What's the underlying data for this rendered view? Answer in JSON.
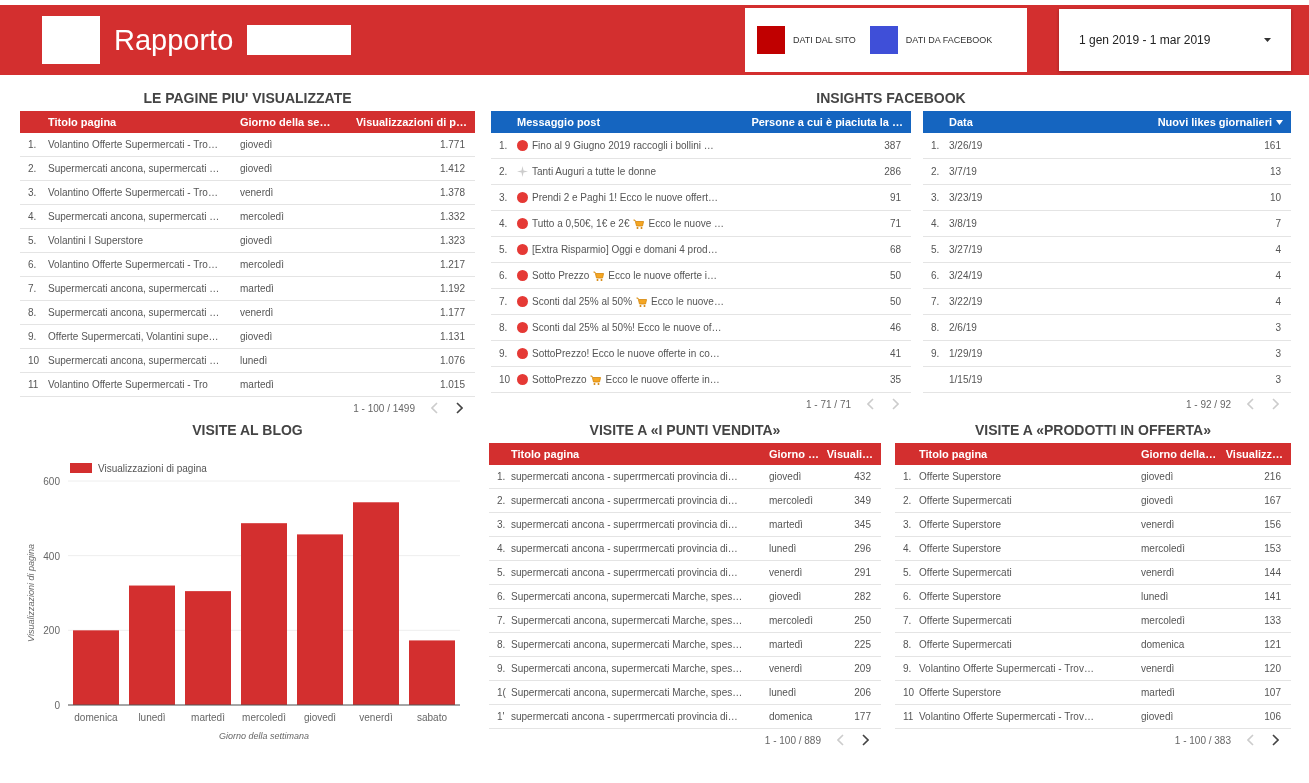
{
  "header": {
    "title": "Rapporto",
    "legend": [
      {
        "label": "DATI DAL SITO",
        "color": "#c00000"
      },
      {
        "label": "DATI DA FACEBOOK",
        "color": "#3f4fd8"
      }
    ],
    "date_range": "1 gen 2019 - 1 mar 2019"
  },
  "top_pages": {
    "title": "LE PAGINE PIU' VISUALIZZATE",
    "columns": [
      {
        "label": "Titolo pagina",
        "sorted": false
      },
      {
        "label": "Giorno della se…",
        "sorted": false
      },
      {
        "label": "Visualizzazioni di p…",
        "sorted": false
      }
    ],
    "rows": [
      {
        "rank": "1.",
        "cells": [
          "Volantino Offerte Supermercati - Tro…",
          "giovedì",
          "1.771"
        ]
      },
      {
        "rank": "2.",
        "cells": [
          "Supermercati ancona, supermercati …",
          "giovedì",
          "1.412"
        ]
      },
      {
        "rank": "3.",
        "cells": [
          "Volantino Offerte Supermercati - Tro…",
          "venerdì",
          "1.378"
        ]
      },
      {
        "rank": "4.",
        "cells": [
          "Supermercati ancona, supermercati …",
          "mercoledì",
          "1.332"
        ]
      },
      {
        "rank": "5.",
        "cells": [
          "Volantini  I Superstore",
          "giovedì",
          "1.323"
        ]
      },
      {
        "rank": "6.",
        "cells": [
          "Volantino Offerte Supermercati - Tro…",
          "mercoledì",
          "1.217"
        ]
      },
      {
        "rank": "7.",
        "cells": [
          "Supermercati ancona, supermercati …",
          "martedì",
          "1.192"
        ]
      },
      {
        "rank": "8.",
        "cells": [
          "Supermercati ancona, supermercati …",
          "venerdì",
          "1.177"
        ]
      },
      {
        "rank": "9.",
        "cells": [
          "Offerte Supermercati, Volantini supe…",
          "giovedì",
          "1.131"
        ]
      },
      {
        "rank": "10",
        "cells": [
          "Supermercati ancona, supermercati …",
          "lunedì",
          "1.076"
        ]
      },
      {
        "rank": "11",
        "cells": [
          "Volantino Offerte Supermercati - Tro",
          "martedì",
          "1.015"
        ]
      }
    ],
    "pager": {
      "text": "1 - 100 / 1499",
      "prev_disabled": true,
      "next_disabled": false
    }
  },
  "facebook": {
    "title": "INSIGHTS FACEBOOK",
    "posts": {
      "columns": [
        {
          "label": "Messaggio post",
          "sorted": false
        },
        {
          "label": "Persone a cui è piaciuta la …",
          "sorted": false
        }
      ],
      "rows": [
        {
          "rank": "1.",
          "kind": "dot",
          "text": "Fino al 9 Giugno 2019 raccogli i bollini …",
          "value": "387"
        },
        {
          "rank": "2.",
          "kind": "sparkle",
          "text": "Tanti Auguri a tutte le donne",
          "value": "286"
        },
        {
          "rank": "3.",
          "kind": "dot",
          "text": "Prendi 2 e Paghi 1! Ecco le nuove offert…",
          "value": "91"
        },
        {
          "rank": "4.",
          "kind": "dot",
          "text": "Tutto a 0,50€, 1€ e 2€",
          "cart": true,
          "text_after": "Ecco le nuove …",
          "value": "71"
        },
        {
          "rank": "5.",
          "kind": "dot",
          "text": "[Extra Risparmio] Oggi e domani 4 prod…",
          "value": "68"
        },
        {
          "rank": "6.",
          "kind": "dot",
          "text": "Sotto Prezzo",
          "cart": true,
          "text_after": "Ecco le nuove offerte i…",
          "value": "50"
        },
        {
          "rank": "7.",
          "kind": "dot",
          "text": "Sconti dal 25% al 50%",
          "cart": true,
          "text_after": "Ecco le nuove…",
          "value": "50"
        },
        {
          "rank": "8.",
          "kind": "dot",
          "text": "Sconti dal 25% al 50%! Ecco le nuove of…",
          "value": "46"
        },
        {
          "rank": "9.",
          "kind": "dot",
          "text": "SottoPrezzo! Ecco le nuove offerte in co…",
          "value": "41"
        },
        {
          "rank": "10",
          "kind": "dot",
          "text": "SottoPrezzo",
          "cart": true,
          "text_after": "Ecco le nuove offerte in…",
          "value": "35"
        }
      ],
      "pager": {
        "text": "1 - 71 / 71",
        "prev_disabled": true,
        "next_disabled": true
      }
    },
    "likes": {
      "columns": [
        {
          "label": "Data",
          "sorted": false
        },
        {
          "label": "Nuovi likes giornalieri",
          "sorted": true
        }
      ],
      "rows": [
        {
          "rank": "1.",
          "cells": [
            "3/26/19",
            "161"
          ]
        },
        {
          "rank": "2.",
          "cells": [
            "3/7/19",
            "13"
          ]
        },
        {
          "rank": "3.",
          "cells": [
            "3/23/19",
            "10"
          ]
        },
        {
          "rank": "4.",
          "cells": [
            "3/8/19",
            "7"
          ]
        },
        {
          "rank": "5.",
          "cells": [
            "3/27/19",
            "4"
          ]
        },
        {
          "rank": "6.",
          "cells": [
            "3/24/19",
            "4"
          ]
        },
        {
          "rank": "7.",
          "cells": [
            "3/22/19",
            "4"
          ]
        },
        {
          "rank": "8.",
          "cells": [
            "2/6/19",
            "3"
          ]
        },
        {
          "rank": "9.",
          "cells": [
            "1/29/19",
            "3"
          ]
        },
        {
          "cells": [
            "1/15/19",
            "3"
          ]
        }
      ],
      "pager": {
        "text": "1 - 92 / 92",
        "prev_disabled": true,
        "next_disabled": true
      }
    }
  },
  "blog": {
    "title": "VISITE AL BLOG",
    "chart_data": {
      "type": "bar",
      "xlabel": "Giorno della settimana",
      "ylabel": "Visualizzazioni di pagina",
      "categories": [
        "domenica",
        "lunedì",
        "martedì",
        "mercoledì",
        "giovedì",
        "venerdì",
        "sabato"
      ],
      "series": [
        {
          "name": "Visualizzazioni di pagina",
          "color": "#d32f2f",
          "values": [
            200,
            320,
            305,
            487,
            457,
            543,
            173
          ]
        }
      ],
      "ylim": [
        0,
        600
      ],
      "yticks": [
        0,
        200,
        400,
        600
      ]
    }
  },
  "stores": {
    "title": "VISITE A «I PUNTI VENDITA»",
    "columns": [
      {
        "label": "Titolo pagina",
        "sorted": false
      },
      {
        "label": "Giorno …",
        "sorted": false
      },
      {
        "label": "Visuali…",
        "sorted": false
      }
    ],
    "rows": [
      {
        "rank": "1.",
        "cells": [
          "supermercati ancona - superrmercati provincia di…",
          "giovedì",
          "432"
        ]
      },
      {
        "rank": "2.",
        "cells": [
          "supermercati ancona - superrmercati provincia di…",
          "mercoledì",
          "349"
        ]
      },
      {
        "rank": "3.",
        "cells": [
          "supermercati ancona - superrmercati provincia di…",
          "martedì",
          "345"
        ]
      },
      {
        "rank": "4.",
        "cells": [
          "supermercati ancona - superrmercati provincia di…",
          "lunedì",
          "296"
        ]
      },
      {
        "rank": "5.",
        "cells": [
          "supermercati ancona - superrmercati provincia di…",
          "venerdì",
          "291"
        ]
      },
      {
        "rank": "6.",
        "cells": [
          "Supermercati ancona, supermercati Marche, spes…",
          "giovedì",
          "282"
        ]
      },
      {
        "rank": "7.",
        "cells": [
          "Supermercati ancona, supermercati Marche, spes…",
          "mercoledì",
          "250"
        ]
      },
      {
        "rank": "8.",
        "cells": [
          "Supermercati ancona, supermercati Marche, spes…",
          "martedì",
          "225"
        ]
      },
      {
        "rank": "9.",
        "cells": [
          "Supermercati ancona, supermercati Marche, spes…",
          "venerdì",
          "209"
        ]
      },
      {
        "rank": "1(",
        "cells": [
          "Supermercati ancona, supermercati Marche, spes…",
          "lunedì",
          "206"
        ]
      },
      {
        "rank": "1'",
        "cells": [
          "supermercati ancona - superrmercati provincia di…",
          "domenica",
          "177"
        ]
      }
    ],
    "pager": {
      "text": "1 - 100 / 889",
      "prev_disabled": true,
      "next_disabled": false
    }
  },
  "offers": {
    "title": "VISITE A «PRODOTTI IN OFFERTA»",
    "columns": [
      {
        "label": "Titolo pagina",
        "sorted": false
      },
      {
        "label": "Giorno della…",
        "sorted": false
      },
      {
        "label": "Visualizz…",
        "sorted": false
      }
    ],
    "rows": [
      {
        "rank": "1.",
        "cells": [
          "Offerte Superstore",
          "giovedì",
          "216"
        ]
      },
      {
        "rank": "2.",
        "cells": [
          "Offerte Supermercati",
          "giovedì",
          "167"
        ]
      },
      {
        "rank": "3.",
        "cells": [
          "Offerte Superstore",
          "venerdì",
          "156"
        ]
      },
      {
        "rank": "4.",
        "cells": [
          "Offerte Superstore",
          "mercoledì",
          "153"
        ]
      },
      {
        "rank": "5.",
        "cells": [
          "Offerte Supermercati",
          "venerdì",
          "144"
        ]
      },
      {
        "rank": "6.",
        "cells": [
          "Offerte Superstore",
          "lunedì",
          "141"
        ]
      },
      {
        "rank": "7.",
        "cells": [
          "Offerte Supermercati",
          "mercoledì",
          "133"
        ]
      },
      {
        "rank": "8.",
        "cells": [
          "Offerte Supermercati",
          "domenica",
          "121"
        ]
      },
      {
        "rank": "9.",
        "cells": [
          "Volantino Offerte Supermercati - Trov…",
          "venerdì",
          "120"
        ]
      },
      {
        "rank": "10",
        "cells": [
          "Offerte Superstore",
          "martedì",
          "107"
        ]
      },
      {
        "rank": "11",
        "cells": [
          "Volantino Offerte Supermercati - Trov…",
          "giovedì",
          "106"
        ]
      }
    ],
    "pager": {
      "text": "1 - 100 / 383",
      "prev_disabled": true,
      "next_disabled": false
    }
  }
}
